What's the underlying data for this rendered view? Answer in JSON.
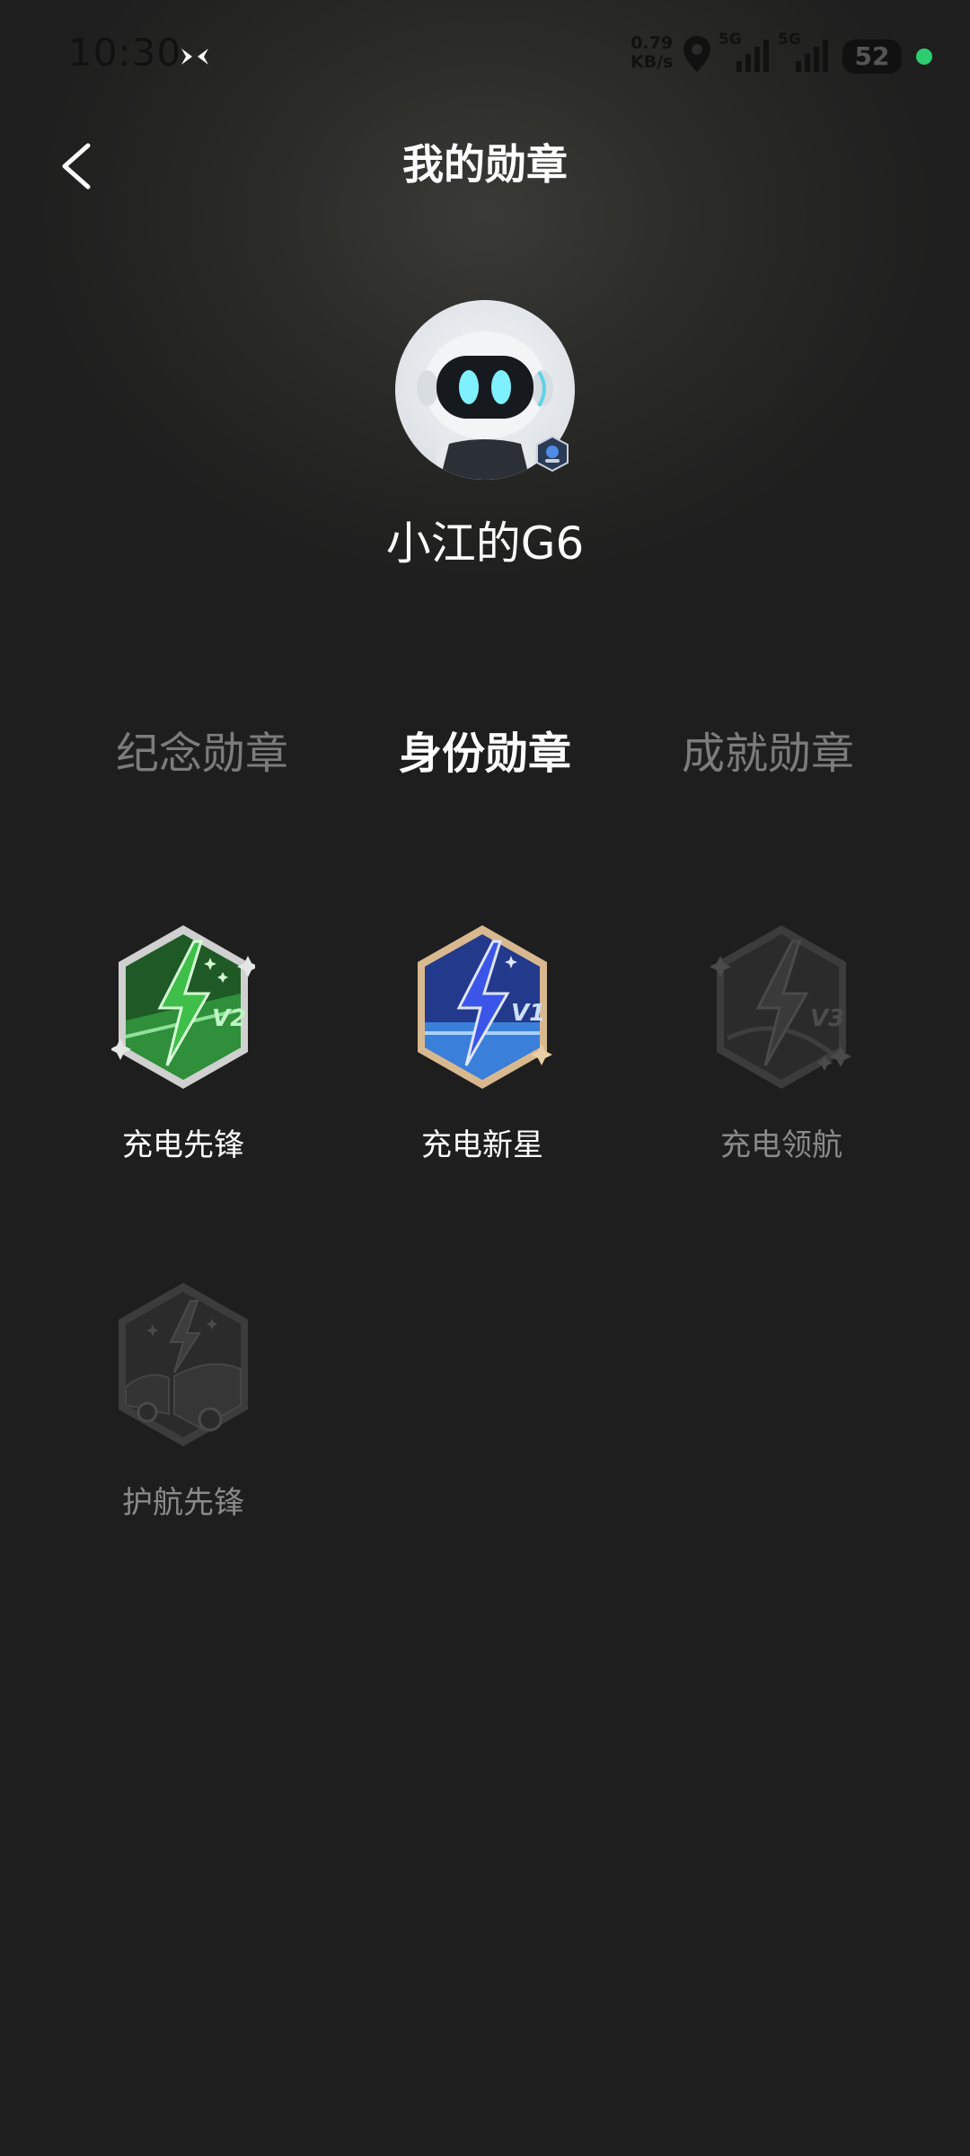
{
  "status_bar": {
    "time": "10:30",
    "net_speed_value": "0.79",
    "net_speed_unit": "KB/s",
    "signal_1_label": "5G",
    "signal_2_label": "5G",
    "battery": "52",
    "status_dot_color": "#2ecc71"
  },
  "header": {
    "title": "我的勋章",
    "back_icon": "chevron-left-icon"
  },
  "profile": {
    "avatar_icon": "robot-avatar",
    "username": "小江的G6"
  },
  "tabs": [
    {
      "label": "纪念勋章",
      "active": false
    },
    {
      "label": "身份勋章",
      "active": true
    },
    {
      "label": "成就勋章",
      "active": false
    }
  ],
  "badges": [
    {
      "label": "充电先锋",
      "level": "V2",
      "unlocked": true,
      "color": "#2f8f3a"
    },
    {
      "label": "充电新星",
      "level": "V1",
      "unlocked": true,
      "color": "#2f49c8"
    },
    {
      "label": "充电领航",
      "level": "V3",
      "unlocked": false,
      "color": "#3a3a3a"
    },
    {
      "label": "护航先锋",
      "level": "",
      "unlocked": false,
      "color": "#3a3a3a"
    }
  ],
  "theme": {
    "background": "#1e1e1e",
    "inactive_tab": "#7c7c7c",
    "locked_label": "#8a8a8a"
  }
}
